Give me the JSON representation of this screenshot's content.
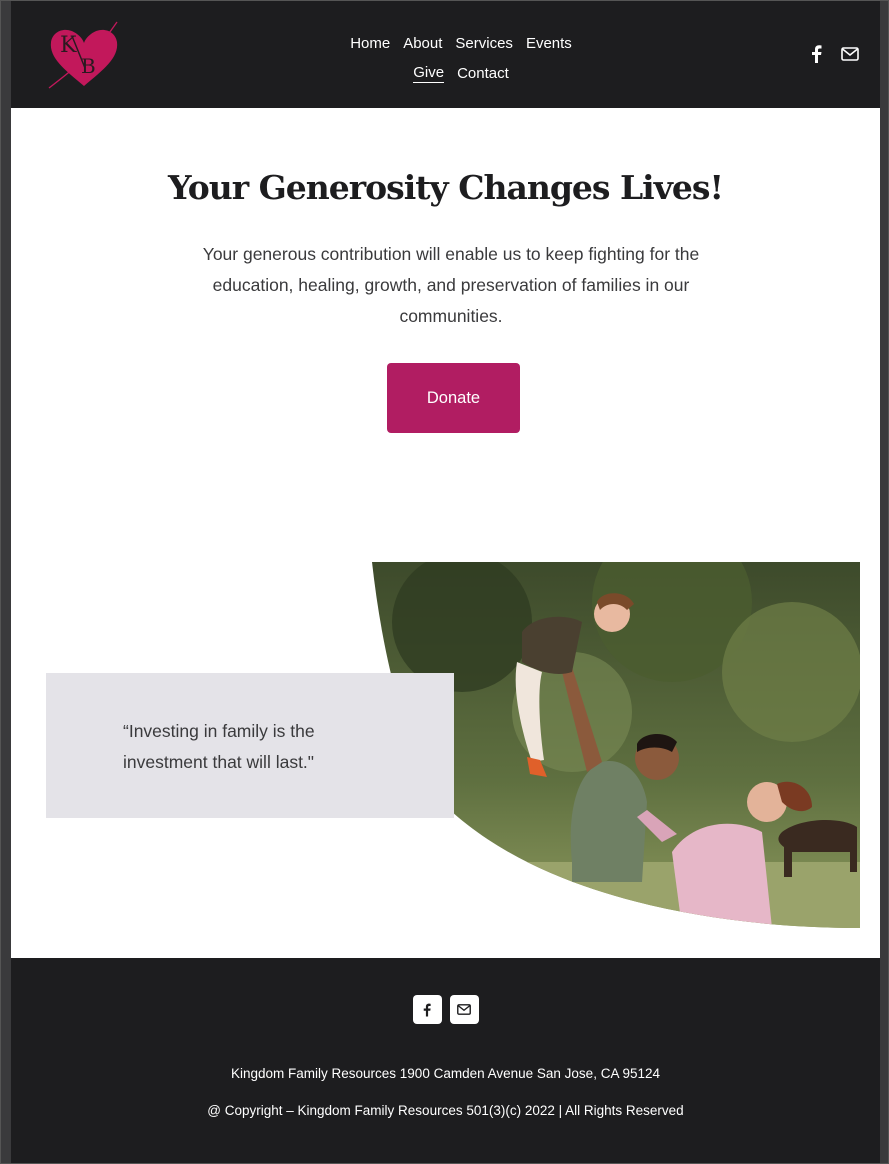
{
  "brand": {
    "logo_letters": "KFB",
    "accent_color": "#c2185b"
  },
  "nav": {
    "row1": [
      "Home",
      "About",
      "Services",
      "Events"
    ],
    "row2": [
      "Give",
      "Contact"
    ],
    "active": "Give"
  },
  "header_icons": [
    "facebook-icon",
    "mail-icon"
  ],
  "hero": {
    "title": "Your Generosity Changes Lives!",
    "text": "Your generous contribution will enable us to keep fighting for the education, healing, growth, and preservation of families in our communities.",
    "donate_label": "Donate",
    "donate_color": "#b11d62"
  },
  "quote": {
    "text": "“Investing in family is the investment that will last.\""
  },
  "footer": {
    "icons": [
      "facebook-icon",
      "mail-icon"
    ],
    "address": "Kingdom Family Resources 1900 Camden Avenue San Jose, CA 95124",
    "copyright": "@ Copyright – Kingdom Family Resources 501(3)(c) 2022 | All Rights Reserved"
  }
}
